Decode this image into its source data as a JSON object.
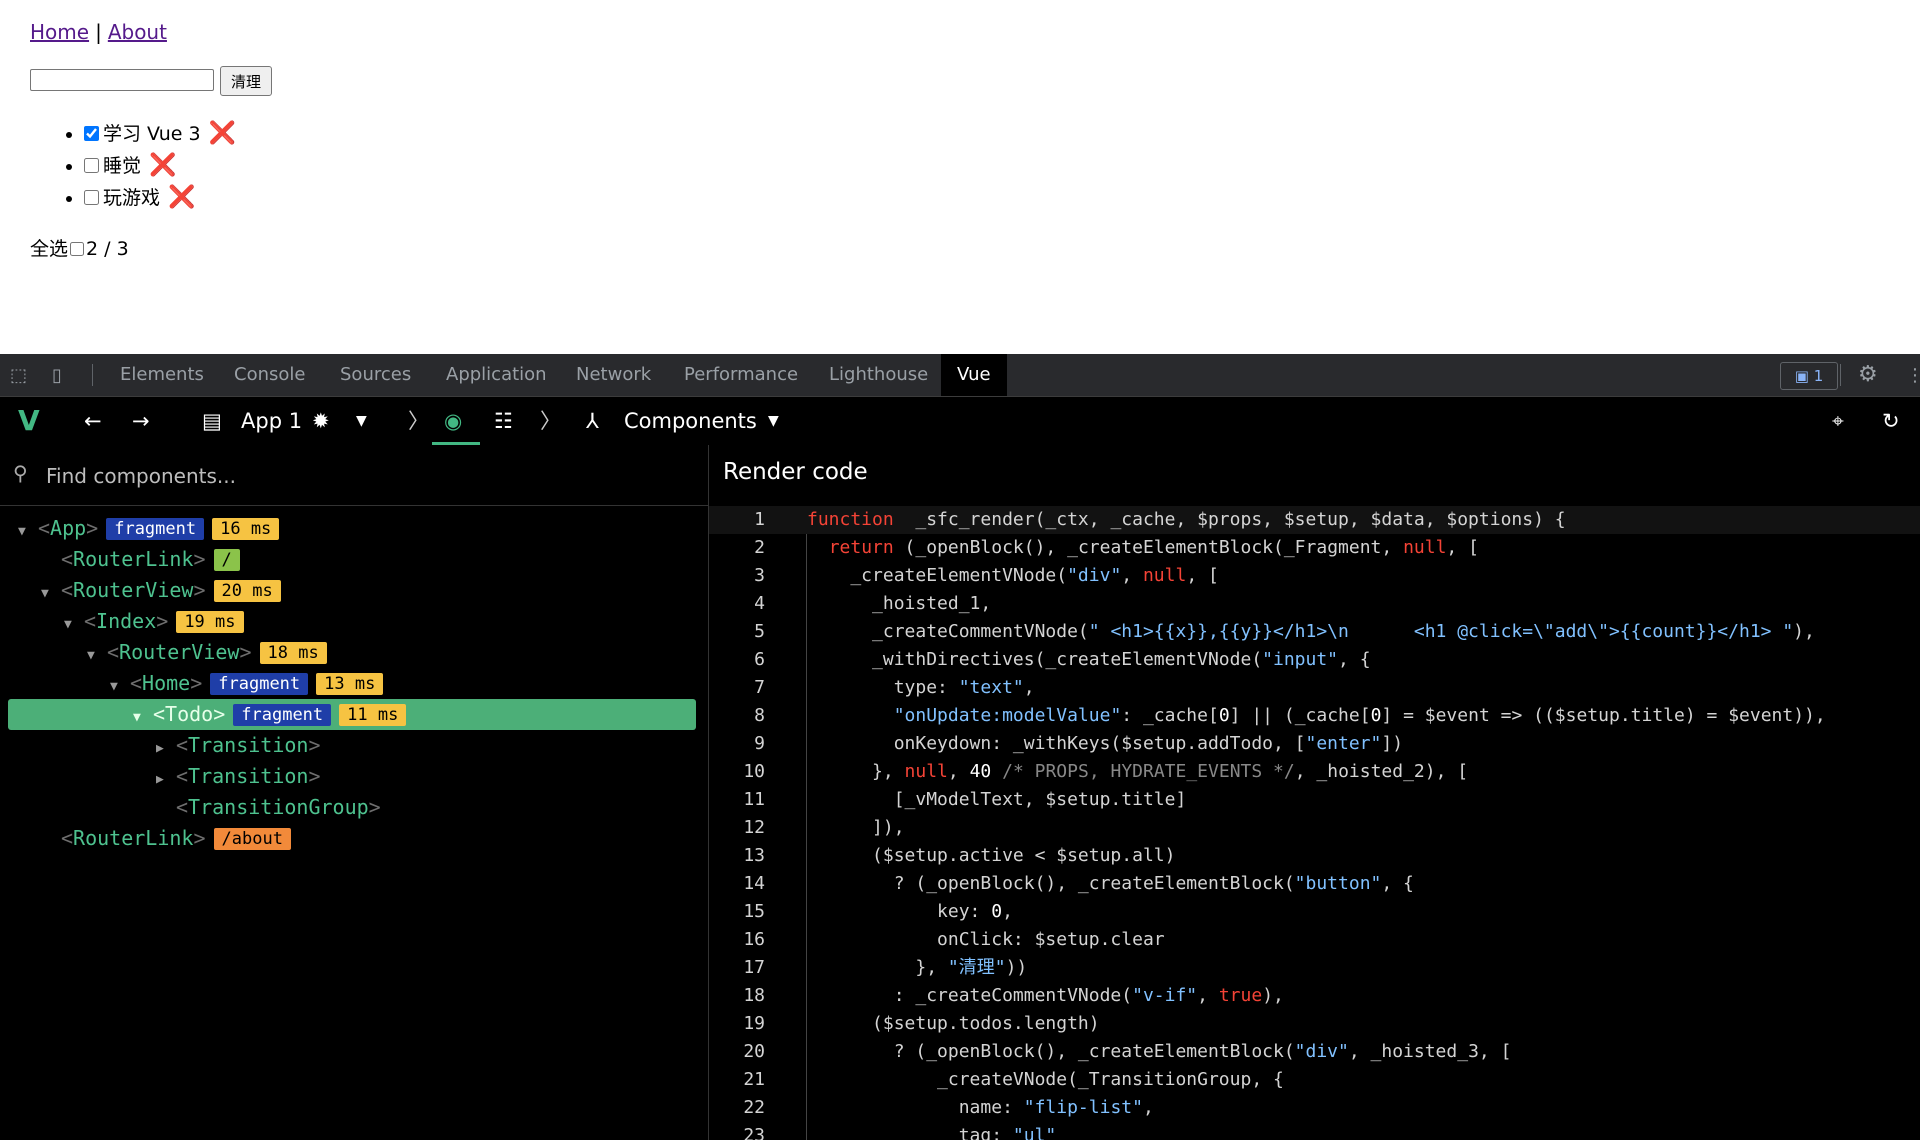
{
  "nav": {
    "home": "Home",
    "sep": "|",
    "about": "About"
  },
  "todo_input": {
    "value": ""
  },
  "clear_label": "清理",
  "todos": [
    {
      "title": "学习 Vue 3",
      "done": true
    },
    {
      "title": "睡觉",
      "done": false
    },
    {
      "title": "玩游戏",
      "done": false
    }
  ],
  "delete_glyph": "❌",
  "footer": {
    "select_all": "全选",
    "count": "2 / 3"
  },
  "devtools_tabs": [
    "Elements",
    "Console",
    "Sources",
    "Application",
    "Network",
    "Performance",
    "Lighthouse",
    "Vue"
  ],
  "active_tab": "Vue",
  "message_count": "1",
  "vue_toolbar": {
    "app": "App 1",
    "view": "Components"
  },
  "search": {
    "placeholder": "Find components..."
  },
  "tree": [
    {
      "indent": 0,
      "arrow": "▼",
      "name": "App",
      "tags": [
        {
          "text": "fragment",
          "kind": "frag"
        },
        {
          "text": "16 ms",
          "kind": "ms"
        }
      ]
    },
    {
      "indent": 1,
      "arrow": "",
      "name": "RouterLink",
      "tags": [
        {
          "text": "/",
          "kind": "root"
        }
      ]
    },
    {
      "indent": 1,
      "arrow": "▼",
      "name": "RouterView",
      "tags": [
        {
          "text": "20 ms",
          "kind": "ms"
        }
      ]
    },
    {
      "indent": 2,
      "arrow": "▼",
      "name": "Index",
      "tags": [
        {
          "text": "19 ms",
          "kind": "ms"
        }
      ]
    },
    {
      "indent": 3,
      "arrow": "▼",
      "name": "RouterView",
      "tags": [
        {
          "text": "18 ms",
          "kind": "ms"
        }
      ]
    },
    {
      "indent": 4,
      "arrow": "▼",
      "name": "Home",
      "tags": [
        {
          "text": "fragment",
          "kind": "frag"
        },
        {
          "text": "13 ms",
          "kind": "ms"
        }
      ]
    },
    {
      "indent": 5,
      "arrow": "▼",
      "name": "Todo",
      "selected": true,
      "tags": [
        {
          "text": "fragment",
          "kind": "frag"
        },
        {
          "text": "11 ms",
          "kind": "ms"
        }
      ]
    },
    {
      "indent": 6,
      "arrow": "▶",
      "name": "Transition",
      "tags": []
    },
    {
      "indent": 6,
      "arrow": "▶",
      "name": "Transition",
      "tags": []
    },
    {
      "indent": 6,
      "arrow": "",
      "name": "TransitionGroup",
      "tags": []
    },
    {
      "indent": 1,
      "arrow": "",
      "name": "RouterLink",
      "tags": [
        {
          "text": "/about",
          "kind": "route"
        }
      ]
    }
  ],
  "render_title": "Render code",
  "code": [
    [
      [
        "kw",
        "function"
      ],
      [
        "",
        "  _sfc_render(_ctx, _cache, $props, $setup, $data, $options) {"
      ]
    ],
    [
      [
        "",
        "  "
      ],
      [
        "kw",
        "return"
      ],
      [
        "",
        " (_openBlock(), _createElementBlock(_Fragment, "
      ],
      [
        "kw",
        "null"
      ],
      [
        "",
        ", ["
      ]
    ],
    [
      [
        "",
        "    _createElementVNode("
      ],
      [
        "str",
        "\"div\""
      ],
      [
        "",
        ", "
      ],
      [
        "kw",
        "null"
      ],
      [
        "",
        ", ["
      ]
    ],
    [
      [
        "",
        "      _hoisted_1,"
      ]
    ],
    [
      [
        "",
        "      _createCommentVNode("
      ],
      [
        "str",
        "\" <h1>{{x}},{{y}}</h1>\\n      <h1 @click=\\\"add\\\">{{count}}</h1> \""
      ],
      [
        "",
        "),"
      ]
    ],
    [
      [
        "",
        "      _withDirectives(_createElementVNode("
      ],
      [
        "str",
        "\"input\""
      ],
      [
        "",
        ", {"
      ]
    ],
    [
      [
        "",
        "        type: "
      ],
      [
        "str",
        "\"text\""
      ],
      [
        "",
        ","
      ]
    ],
    [
      [
        "",
        "        "
      ],
      [
        "str",
        "\"onUpdate:modelValue\""
      ],
      [
        "",
        ": _cache["
      ],
      [
        "num",
        "0"
      ],
      [
        "",
        "] || (_cache["
      ],
      [
        "num",
        "0"
      ],
      [
        "",
        "] = $event => (($setup.title) = $event)),"
      ]
    ],
    [
      [
        "",
        "        onKeydown: _withKeys($setup.addTodo, ["
      ],
      [
        "str",
        "\"enter\""
      ],
      [
        "",
        "])"
      ]
    ],
    [
      [
        "",
        "      }, "
      ],
      [
        "kw",
        "null"
      ],
      [
        "",
        ", "
      ],
      [
        "num",
        "40"
      ],
      [
        "cm",
        " /* PROPS, HYDRATE_EVENTS */"
      ],
      [
        "",
        ", _hoisted_2), ["
      ]
    ],
    [
      [
        "",
        "        [_vModelText, $setup.title]"
      ]
    ],
    [
      [
        "",
        "      ]),"
      ]
    ],
    [
      [
        "",
        "      ($setup.active < $setup.all)"
      ]
    ],
    [
      [
        "",
        "        ? (_openBlock(), _createElementBlock("
      ],
      [
        "str",
        "\"button\""
      ],
      [
        "",
        ", {"
      ]
    ],
    [
      [
        "",
        "            key: "
      ],
      [
        "num",
        "0"
      ],
      [
        "",
        ","
      ]
    ],
    [
      [
        "",
        "            onClick: $setup.clear"
      ]
    ],
    [
      [
        "",
        "          }, "
      ],
      [
        "str",
        "\"清理\""
      ],
      [
        "",
        "))"
      ]
    ],
    [
      [
        "",
        "        : _createCommentVNode("
      ],
      [
        "str",
        "\"v-if\""
      ],
      [
        "",
        ", "
      ],
      [
        "kw",
        "true"
      ],
      [
        "",
        "),"
      ]
    ],
    [
      [
        "",
        "      ($setup.todos.length)"
      ]
    ],
    [
      [
        "",
        "        ? (_openBlock(), _createElementBlock("
      ],
      [
        "str",
        "\"div\""
      ],
      [
        "",
        ", _hoisted_3, ["
      ]
    ],
    [
      [
        "",
        "            _createVNode(_TransitionGroup, {"
      ]
    ],
    [
      [
        "",
        "              name: "
      ],
      [
        "str",
        "\"flip-list\""
      ],
      [
        "",
        ","
      ]
    ],
    [
      [
        "",
        "              tag: "
      ],
      [
        "str",
        "\"ul\""
      ]
    ]
  ]
}
